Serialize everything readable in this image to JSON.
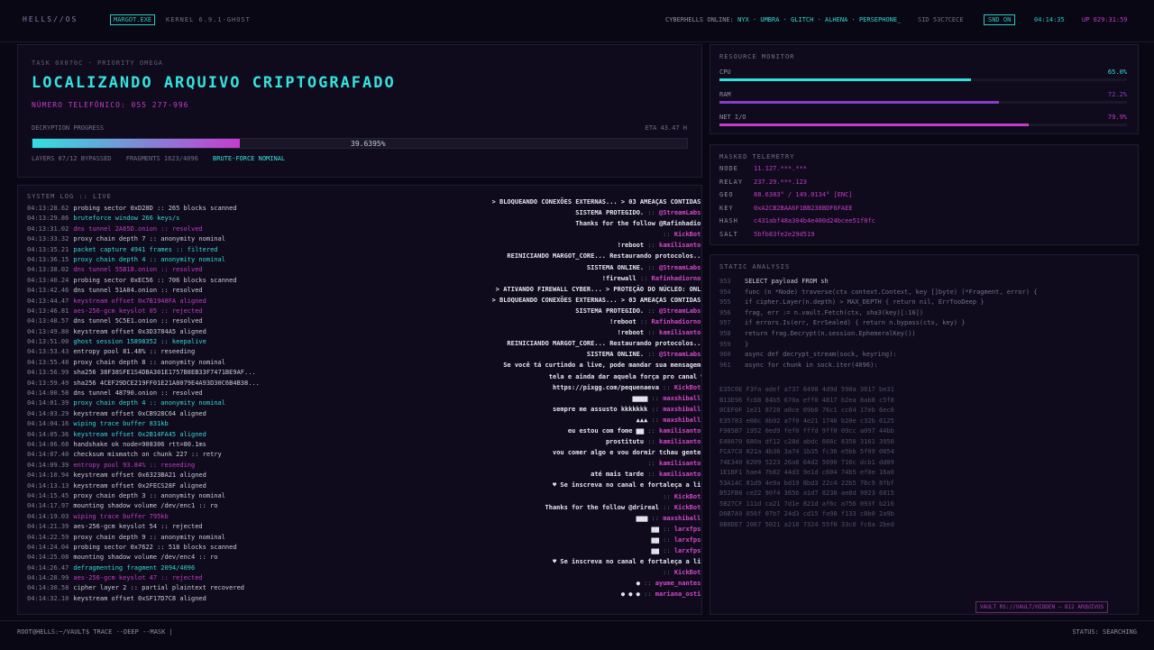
{
  "topbar": {
    "brand": "HELLS//OS",
    "user_badge": "MARGOT.EXE",
    "kernel": "KERNEL 6.9.1-GHOST",
    "online_label": "CYBERHELLS ONLINE:",
    "online_users": "NYX · UMBRA · GLITCH · ALHENA · PERSEPHONE_",
    "sid": "SID 53C7CECE",
    "sound": "SND ON",
    "clock": "04:14:35",
    "uptime": "UP 029:31:59"
  },
  "task": {
    "id": "TASK 0X070C · PRIORITY OMEGA",
    "title": "LOCALIZANDO ARQUIVO CRIPTOGRAFADO",
    "phone": "NÚMERO TELEFÔNICO: 055 277-996",
    "progress_label": "DECRYPTION PROGRESS",
    "eta": "ETA 43.47 H",
    "progress_pct": 39.6395,
    "progress_text": "39.6395%",
    "layers": "LAYERS 07/12 BYPASSED",
    "fragments": "FRAGMENTS 1623/4096",
    "bruteforce": "BRUTE-FORCE NOMINAL"
  },
  "log": {
    "title": "SYSTEM LOG :: LIVE",
    "lines": [
      {
        "time": "04:13:28.62",
        "text": "probing sector 0xD28D :: 265 blocks scanned",
        "color": "white"
      },
      {
        "time": "04:13:29.86",
        "text": "bruteforce window 266 keys/s",
        "color": "cyan"
      },
      {
        "time": "04:13:31.02",
        "text": "dns tunnel 2A65D.onion :: resolved",
        "color": "magenta"
      },
      {
        "time": "04:13:33.32",
        "text": "proxy chain depth 7 :: anonymity nominal",
        "color": "white"
      },
      {
        "time": "04:13:35.21",
        "text": "packet capture 4941 frames :: filtered",
        "color": "cyan"
      },
      {
        "time": "04:13:36.15",
        "text": "proxy chain depth 4 :: anonymity nominal",
        "color": "cyan"
      },
      {
        "time": "04:13:38.02",
        "text": "dns tunnel 55B18.onion :: resolved",
        "color": "magenta"
      },
      {
        "time": "04:13:40.24",
        "text": "probing sector 0xEC56 :: 706 blocks scanned",
        "color": "white"
      },
      {
        "time": "04:13:42.46",
        "text": "dns tunnel 51A04.onion :: resolved",
        "color": "white"
      },
      {
        "time": "04:13:44.47",
        "text": "keystream offset 0x7B1948FA aligned",
        "color": "magenta"
      },
      {
        "time": "04:13:46.81",
        "text": "aes-256-gcm keyslot 05 :: rejected",
        "color": "magenta"
      },
      {
        "time": "04:13:48.57",
        "text": "dns tunnel 5C5E1.onion :: resolved",
        "color": "white"
      },
      {
        "time": "04:13:49.80",
        "text": "keystream offset 0x3D3784A5 aligned",
        "color": "white"
      },
      {
        "time": "04:13:51.00",
        "text": "ghost session 15898352 :: keepalive",
        "color": "cyan"
      },
      {
        "time": "04:13:53.43",
        "text": "entropy pool 81.48% :: reseeding",
        "color": "white"
      },
      {
        "time": "04:13:55.48",
        "text": "proxy chain depth 8 :: anonymity nominal",
        "color": "white"
      },
      {
        "time": "04:13:56.99",
        "text": "sha256 38F38SFE1S4DBA301E1757B8EB33F7471BE9AF...",
        "color": "white"
      },
      {
        "time": "04:13:59.49",
        "text": "sha256 4CEF29DCE219FF01E21A8079E4A93D30C6B4B38...",
        "color": "white"
      },
      {
        "time": "04:14:00.58",
        "text": "dns tunnel 48790.onion :: resolved",
        "color": "white"
      },
      {
        "time": "04:14:01.39",
        "text": "proxy chain depth 4 :: anonymity nominal",
        "color": "cyan"
      },
      {
        "time": "04:14:03.29",
        "text": "keystream offset 0xCB928C64 aligned",
        "color": "white"
      },
      {
        "time": "04:14:04.16",
        "text": "wiping trace buffer 831kb",
        "color": "cyan"
      },
      {
        "time": "04:14:05.36",
        "text": "keystream offset 0x2B14FA45 aligned",
        "color": "cyan"
      },
      {
        "time": "04:14:06.68",
        "text": "handshake ok node=908306 rtt=80.1ms",
        "color": "white"
      },
      {
        "time": "04:14:07.40",
        "text": "checksum mismatch on chunk 227 :: retry",
        "color": "white"
      },
      {
        "time": "04:14:09.39",
        "text": "entropy pool 93.84% :: reseeding",
        "color": "magenta"
      },
      {
        "time": "04:14:10.94",
        "text": "keystream offset 0x6323BA21 aligned",
        "color": "white"
      },
      {
        "time": "04:14:13.13",
        "text": "keystream offset 0x2FECS28F aligned",
        "color": "white"
      },
      {
        "time": "04:14:15.45",
        "text": "proxy chain depth 3 :: anonymity nominal",
        "color": "white"
      },
      {
        "time": "04:14:17.97",
        "text": "mounting shadow volume /dev/enc1 :: ro",
        "color": "white"
      },
      {
        "time": "04:14:19.03",
        "text": "wiping trace buffer 795kb",
        "color": "magenta"
      },
      {
        "time": "04:14:21.39",
        "text": "aes-256-gcm keyslot 54 :: rejected",
        "color": "white"
      },
      {
        "time": "04:14:22.59",
        "text": "proxy chain depth 9 :: anonymity nominal",
        "color": "white"
      },
      {
        "time": "04:14:24.04",
        "text": "probing sector 0x7622 :: 518 blocks scanned",
        "color": "white"
      },
      {
        "time": "04:14:25.08",
        "text": "mounting shadow volume /dev/enc4 :: ro",
        "color": "white"
      },
      {
        "time": "04:14:26.47",
        "text": "defragmenting fragment 2094/4096",
        "color": "cyan"
      },
      {
        "time": "04:14:28.99",
        "text": "aes-256-gcm keyslot 47 :: rejected",
        "color": "magenta"
      },
      {
        "time": "04:14:30.58",
        "text": "cipher layer 2 :: partial plaintext recovered",
        "color": "white"
      },
      {
        "time": "04:14:32.10",
        "text": "keystream offset 0xSF17D7C8 aligned",
        "color": "white"
      }
    ]
  },
  "chat": [
    {
      "msg": "> BLOQUEANDO CONEXÕES EXTERNAS... > 03 AMEAÇAS CONTIDAS. >",
      "user": "",
      "dim": true
    },
    {
      "msg": "SISTEMA PROTEGIDO.",
      "user": "@StreamLabs",
      "dim": true
    },
    {
      "msg": "Thanks for the follow @Rafinhadiorno",
      "user": "",
      "dim": false
    },
    {
      "msg": "",
      "user": "KickBot",
      "dim": false
    },
    {
      "msg": "!reboot",
      "user": "kamilisanto",
      "dim": false
    },
    {
      "msg": "REINICIANDO MARGOT_CORE... Restaurando protocolos... ●",
      "user": "",
      "dim": false
    },
    {
      "msg": "SISTEMA ONLINE.",
      "user": "@StreamLabs",
      "dim": false
    },
    {
      "msg": "!firewall",
      "user": "Rafinhadiorno",
      "dim": false
    },
    {
      "msg": "> ATIVANDO FIREWALL CYBER... > PROTEÇÃO DO NÚCLEO: ONLINE",
      "user": "",
      "dim": false
    },
    {
      "msg": "> BLOQUEANDO CONEXÕES EXTERNAS... > 03 AMEAÇAS CONTIDAS. >",
      "user": "",
      "dim": false
    },
    {
      "msg": "SISTEMA PROTEGIDO.",
      "user": "@StreamLabs",
      "dim": false
    },
    {
      "msg": "!reboot",
      "user": "Rafinhadiorno",
      "dim": false
    },
    {
      "msg": "!reboot",
      "user": "kamilisanto",
      "dim": false
    },
    {
      "msg": "REINICIANDO MARGOT_CORE... Restaurando protocolos... ●",
      "user": "",
      "dim": false
    },
    {
      "msg": "SISTEMA ONLINE.",
      "user": "@StreamLabs",
      "dim": false
    },
    {
      "msg": "Se você tá curtindo a live, pode mandar sua mensagem na",
      "user": "",
      "dim": false
    },
    {
      "msg": "tela e ainda dar aquela força pro canal ♥ →",
      "user": "",
      "dim": false
    },
    {
      "msg": "https://pixgg.com/pequenaeva",
      "user": "KickBot",
      "dim": false
    },
    {
      "msg": "▆▆▆▆",
      "user": "maxshiball",
      "dim": false
    },
    {
      "msg": "sempre me assusto kkkkkkk",
      "user": "maxshiball",
      "dim": false
    },
    {
      "msg": "▲▲▲",
      "user": "maxshiball",
      "dim": false
    },
    {
      "msg": "eu estou com fome ▆▆",
      "user": "kamilisanto",
      "dim": false
    },
    {
      "msg": "prostitutu",
      "user": "kamilisanto",
      "dim": false
    },
    {
      "msg": "vou comer algo e vou dormir tchau gente ▆▆",
      "user": "",
      "dim": false
    },
    {
      "msg": "",
      "user": "kamilisanto",
      "dim": false
    },
    {
      "msg": "até mais tarde",
      "user": "kamilisanto",
      "dim": false
    },
    {
      "msg": "♥ Se inscreva no canal e fortaleça a live!",
      "user": "",
      "dim": false
    },
    {
      "msg": "",
      "user": "KickBot",
      "dim": false
    },
    {
      "msg": "Thanks for the follow @drireal",
      "user": "KickBot",
      "dim": false
    },
    {
      "msg": "▆▆▆",
      "user": "maxshiball",
      "dim": false
    },
    {
      "msg": "▆▆",
      "user": "larxfps",
      "dim": false
    },
    {
      "msg": "▆▆",
      "user": "larxfps",
      "dim": false
    },
    {
      "msg": "▆▆",
      "user": "larxfps",
      "dim": false
    },
    {
      "msg": "♥ Se inscreva no canal e fortaleça a live!",
      "user": "",
      "dim": false
    },
    {
      "msg": "",
      "user": "KickBot",
      "dim": false
    },
    {
      "msg": "●",
      "user": "ayume_nantes",
      "dim": false
    },
    {
      "msg": "● ● ●",
      "user": "mariana_osti",
      "dim": false
    }
  ],
  "resources": {
    "title": "RESOURCE MONITOR",
    "cpu": {
      "label": "CPU",
      "pct": 65.0,
      "text": "65.0%",
      "color": "#2fe0dc"
    },
    "ram": {
      "label": "RAM",
      "pct": 72.2,
      "text": "72.2%",
      "color": "#8a3cc8"
    },
    "net": {
      "label": "NET I/O",
      "pct": 79.9,
      "text": "79.9%",
      "color": "#c73bc8"
    }
  },
  "telemetry": {
    "title": "MASKED TELEMETRY",
    "rows": [
      {
        "k": "NODE",
        "v": "11.127.***.***"
      },
      {
        "k": "RELAY",
        "v": "237.29.***.123"
      },
      {
        "k": "GEO",
        "v": "88.6383° / 149.0134° [ENC]"
      },
      {
        "k": "KEY",
        "v": "0xA2CB2BAA6F1BB238BDF6FAEE"
      },
      {
        "k": "HASH",
        "v": "c431abf48a304b4e400d24bcee51f0fc"
      },
      {
        "k": "SALT",
        "v": "5bfb83fe2e29d519"
      }
    ]
  },
  "static": {
    "title": "STATIC ANALYSIS",
    "code": [
      {
        "n": "953",
        "text": "SELECT payload FROM sh",
        "active": true
      },
      {
        "n": "954",
        "text": "func (n *Node) traverse(ctx context.Context, key []byte) (*Fragment, error) {",
        "active": false
      },
      {
        "n": "955",
        "text": "if cipher.Layer(n.depth) > MAX_DEPTH { return nil, ErrTooDeep }",
        "active": false
      },
      {
        "n": "956",
        "text": "frag, err := n.vault.Fetch(ctx, sha3(key)[:16])",
        "active": false
      },
      {
        "n": "957",
        "text": "if errors.Is(err, ErrSealed) { return n.bypass(ctx, key) }",
        "active": false
      },
      {
        "n": "958",
        "text": "return frag.Decrypt(n.session.EphemeralKey())",
        "active": false
      },
      {
        "n": "959",
        "text": "}",
        "active": false
      },
      {
        "n": "960",
        "text": "async def decrypt_stream(sock, keyring):",
        "active": false
      },
      {
        "n": "961",
        "text": "async for chunk in sock.iter(4096):",
        "active": false
      }
    ],
    "hex": [
      "E35C0E F3fa adef a737 6498 4d9d 598a 3617 be31",
      "B13E96 fc68 84b5 670a eff0 4817 b2ea 8ab8 c5f8",
      "0CEF0F 1e21 8720 a0ce 09b0 76c1 cc64 17eb 6ec0",
      "E35783 e08c 8b92 a7f0 4e21 1746 b20e c32b 6125",
      "F985B7 1952 0ed9 fef0 fffd 9ff0 09cc a097 44bb",
      "E40070 680a df12 c28d abdc 666c 8350 3161 3950",
      "FCA7C0 021a 4b36 3a74 1b35 fc36 e5bb 5f09 0054",
      "74E340 0209 5223 26a8 64d2 5090 716c dcb1 dd09",
      "1E1BF1 hae4 7b82 44d3 9e1d c604 74b5 ef0e 16a0",
      "53A14C 81d9 4e9a bd19 8bd3 22c4 22b5 76c9 8fbf",
      "B52FB8 ce22 90f4 3656 a1d7 8238 ae8d 9023 6815",
      "5B27CF 111d ca21 7d1e 821d af6c a756 093f b216",
      "D6B7A9 056f 07b7 24d3 cd15 fa98 f133 c8b0 2a9b",
      "8B8DE7 2067 5021 a218 7324 55f0 33c0 fc6a 2bed"
    ],
    "vault": "VAULT RS://VAULT/HIDDEN — 812 ARQUIVOS"
  },
  "bottom": {
    "prompt": "ROOT@HELLS:~/VAULT$ TRACE --DEEP --MASK |",
    "status": "STATUS: SEARCHING"
  }
}
